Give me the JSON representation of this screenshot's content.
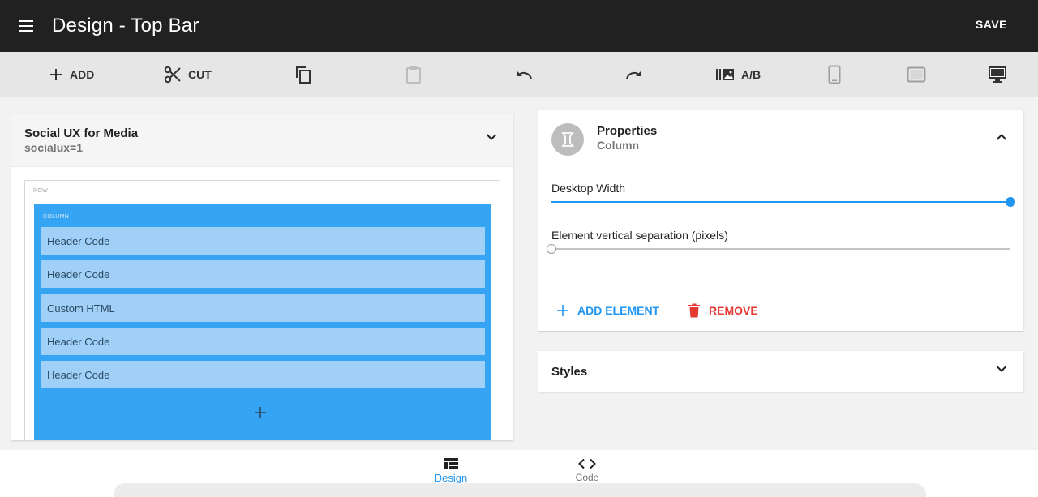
{
  "appbar": {
    "title": "Design - Top Bar",
    "save_label": "SAVE",
    "menu_icon": "menu-icon"
  },
  "toolbar": {
    "add_label": "ADD",
    "cut_label": "CUT",
    "ab_label": "A/B",
    "icons": [
      "add-icon",
      "cut-icon",
      "copy-icon",
      "paste-icon",
      "undo-icon",
      "redo-icon",
      "ab-test-icon",
      "phone-icon",
      "tablet-icon",
      "desktop-icon"
    ]
  },
  "page_panel": {
    "title": "Social UX for Media",
    "subtitle": "socialux=1",
    "row_label": "ROW",
    "column_label": "COLUMN",
    "elements": [
      "Header Code",
      "Header Code",
      "Custom HTML",
      "Header Code",
      "Header Code"
    ],
    "column_color": "#35a4f2",
    "element_color": "#a0d0f7"
  },
  "properties": {
    "title": "Properties",
    "subtitle": "Column",
    "desktop_width_label": "Desktop Width",
    "desktop_width_value": 1.0,
    "separation_label": "Element vertical separation (pixels)",
    "separation_value": 0,
    "add_element_label": "ADD ELEMENT",
    "remove_label": "REMOVE",
    "accent_color": "#2196f3",
    "danger_color": "#e53935"
  },
  "styles": {
    "title": "Styles"
  },
  "bottom_nav": {
    "design_label": "Design",
    "code_label": "Code",
    "active": "Design"
  }
}
